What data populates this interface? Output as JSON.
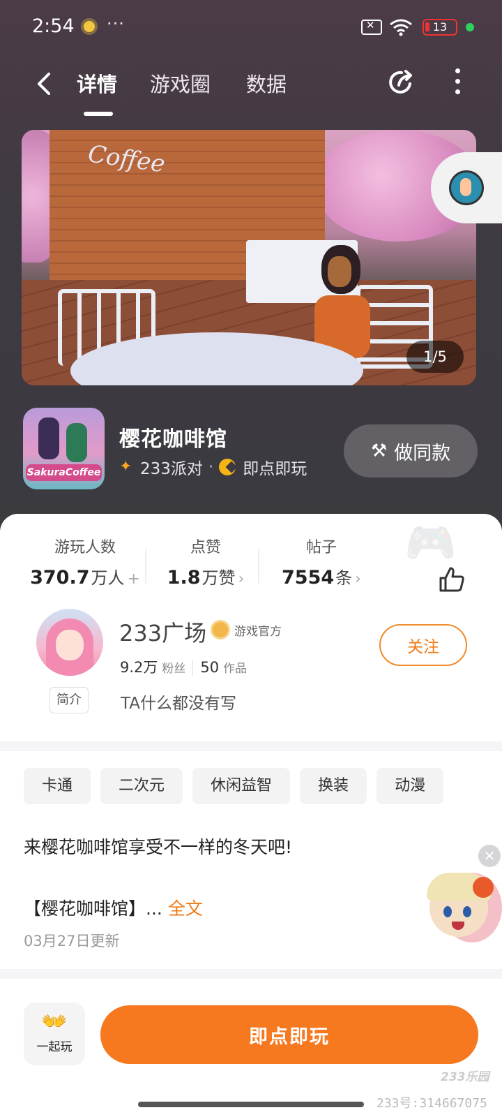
{
  "status_bar": {
    "time": "2:54",
    "more": "···",
    "battery": "13",
    "battery_color": "#e33333",
    "dot_color": "#2ed15e"
  },
  "nav": {
    "tabs": [
      {
        "label": "详情",
        "active": true
      },
      {
        "label": "游戏圈",
        "active": false
      },
      {
        "label": "数据",
        "active": false
      }
    ]
  },
  "banner": {
    "counter": "1/5",
    "sign_text": "Coffee"
  },
  "game": {
    "icon_text": "SakuraCoffee",
    "title": "樱花咖啡馆",
    "category": "233派对",
    "separator": "·",
    "play_mode": "即点即玩",
    "make_same_label": "做同款"
  },
  "stats": {
    "players": {
      "label": "游玩人数",
      "value": "370.7",
      "unit": "万人",
      "suffix": "+"
    },
    "likes": {
      "label": "点赞",
      "value": "1.8",
      "unit": "万赞",
      "suffix": "›"
    },
    "posts": {
      "label": "帖子",
      "value": "7554",
      "unit": "条",
      "suffix": "›"
    }
  },
  "author": {
    "name": "233广场",
    "badge": "游戏官方",
    "fans_value": "9.2万",
    "fans_label": "粉丝",
    "works_value": "50",
    "works_label": "作品",
    "follow_label": "关注",
    "intro_tag": "简介",
    "intro_text": "TA什么都没有写"
  },
  "tags": [
    "卡通",
    "二次元",
    "休闲益智",
    "换装",
    "动漫"
  ],
  "description": {
    "line1": "来樱花咖啡馆享受不一样的冬天吧!",
    "line2": "【樱花咖啡馆】...",
    "more_link": "全文",
    "updated": "03月27日更新"
  },
  "bottom": {
    "together_label": "一起玩",
    "play_label": "即点即玩",
    "accent_color": "#f6781f"
  },
  "watermark": {
    "logo": "233乐园",
    "id_text": "233号:314667075"
  }
}
